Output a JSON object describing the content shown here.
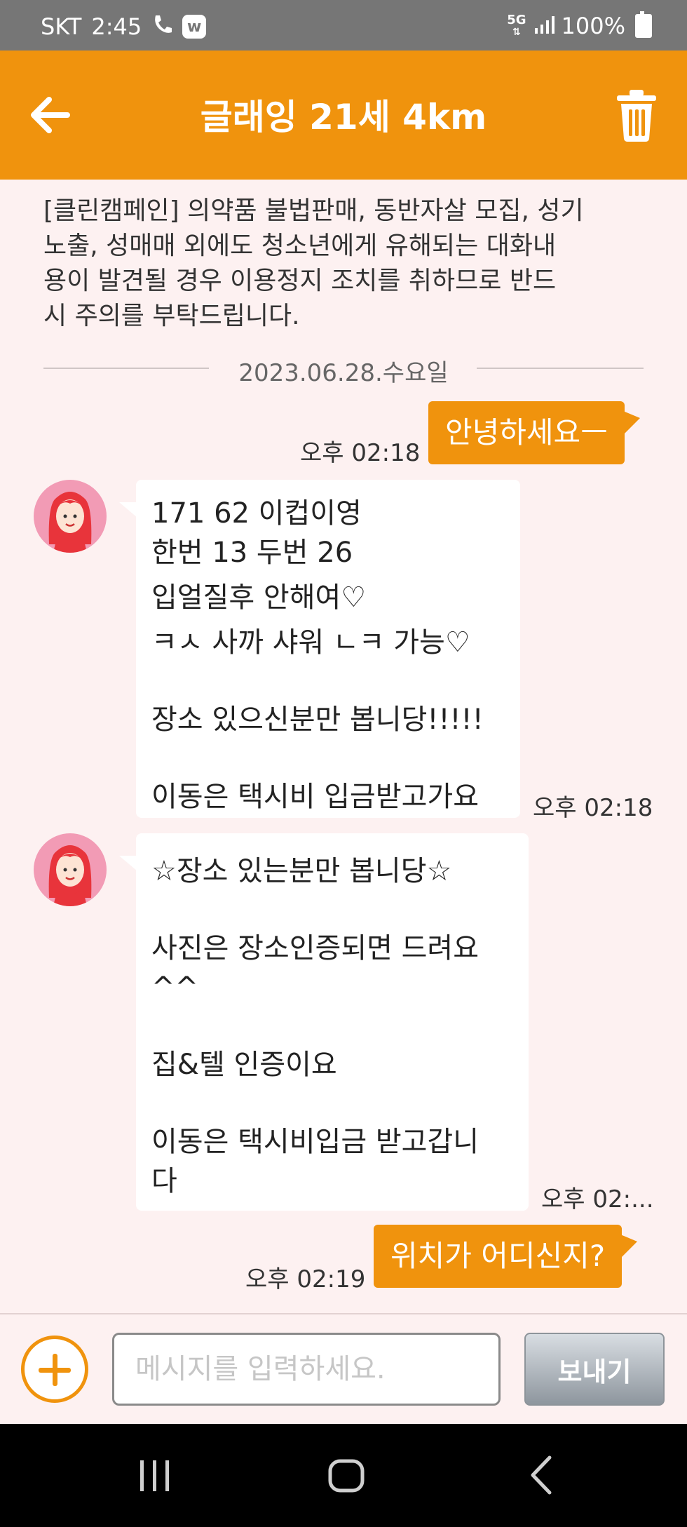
{
  "status_bar": {
    "carrier": "SKT",
    "time": "2:45",
    "app_badge": "w",
    "network": "5G",
    "battery": "100%"
  },
  "header": {
    "title": "글래잉 21세 4km",
    "back_icon": "arrow-left-icon",
    "delete_icon": "trash-icon",
    "bg_color": "#f0930d"
  },
  "notice": {
    "lines": [
      "[클린캠페인] 의약품 불법판매, 동반자살 모집, 성기",
      "노출, 성매매 외에도 청소년에게 유해되는 대화내",
      "용이 발견될 경우 이용정지 조치를 취하므로 반드",
      "시 주의를 부탁드립니다."
    ]
  },
  "date_separator": "2023.06.28.수요일",
  "messages": [
    {
      "direction": "out",
      "time": "오후 02:18",
      "lines": [
        "안녕하세요ㅡ"
      ]
    },
    {
      "direction": "in",
      "time": "오후 02:18",
      "lines": [
        "171 62 이컵이영",
        "한번 13 두번 26",
        "입얼질후 안해여♡",
        "ㅋㅅ 사까 샤워 ㄴㅋ 가능♡",
        "",
        "장소 있으신분만 봅니당!!!!!",
        "",
        "이동은 택시비 입금받고가요"
      ]
    },
    {
      "direction": "in",
      "time": "오후 02:...",
      "lines": [
        "☆장소 있는분만 봅니당☆",
        "",
        "사진은 장소인증되면 드려요",
        "^^",
        "",
        "집&텔 인증이요",
        "",
        "이동은 택시비입금 받고갑니",
        "다"
      ]
    },
    {
      "direction": "out",
      "time": "오후 02:19",
      "lines": [
        "위치가 어디신지?"
      ]
    }
  ],
  "composer": {
    "placeholder": "메시지를 입력하세요.",
    "send_label": "보내기",
    "add_icon": "plus-circle-icon"
  },
  "nav_bar": {
    "recent_icon": "recent-apps-icon",
    "home_icon": "home-icon",
    "back_icon": "back-chevron-icon"
  }
}
